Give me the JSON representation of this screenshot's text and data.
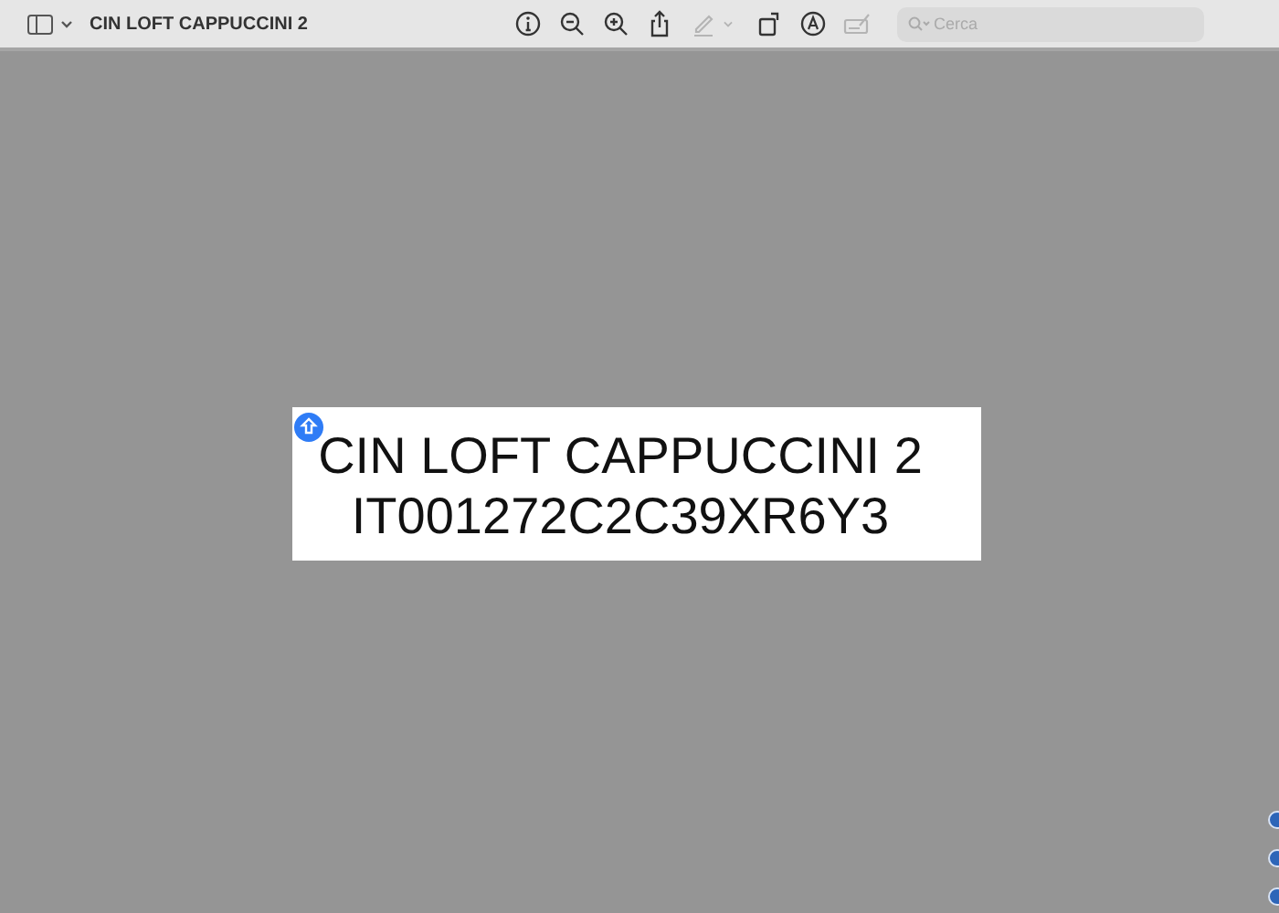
{
  "window": {
    "title": "CIN LOFT CAPPUCCINI 2"
  },
  "toolbar": [
    {
      "kind": "info",
      "disabled": false
    },
    {
      "kind": "zoom-out",
      "disabled": false
    },
    {
      "kind": "zoom-in",
      "disabled": false
    },
    {
      "kind": "share",
      "disabled": false
    },
    {
      "kind": "highlight",
      "disabled": true
    },
    {
      "kind": "caret",
      "disabled": true
    },
    {
      "kind": "rotate",
      "disabled": false
    },
    {
      "kind": "markup",
      "disabled": false
    },
    {
      "kind": "sign",
      "disabled": true
    }
  ],
  "search": {
    "placeholder": "Cerca"
  },
  "document": {
    "lines": [
      "CIN LOFT CAPPUCCINI 2",
      "IT001272C2C39XR6Y3"
    ]
  }
}
